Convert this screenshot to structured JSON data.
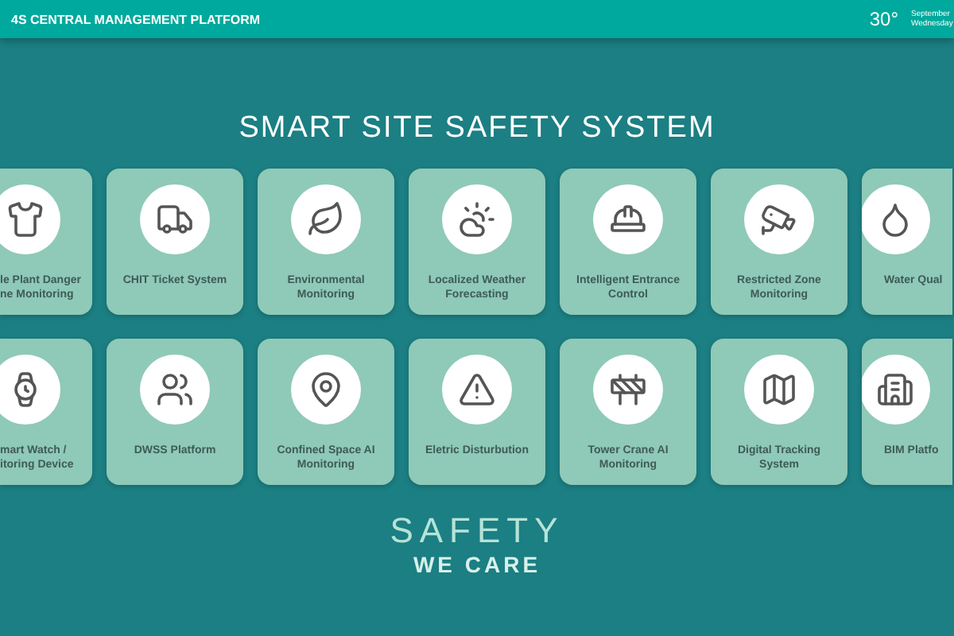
{
  "header": {
    "title": "4S CENTRAL MANAGEMENT PLATFORM",
    "temperature": "30°",
    "date": "September",
    "weekday": "Wednesday"
  },
  "heading": "SMART SITE SAFETY SYSTEM",
  "rows": [
    [
      {
        "kind": "left",
        "lines": [
          "le Plant Danger",
          "ne Monitoring"
        ]
      },
      {
        "kind": "full",
        "lines": [
          "CHIT Ticket System"
        ]
      },
      {
        "kind": "full",
        "lines": [
          "Environmental",
          "Monitoring"
        ]
      },
      {
        "kind": "full",
        "lines": [
          "Localized Weather",
          "Forecasting"
        ]
      },
      {
        "kind": "full",
        "lines": [
          "Intelligent Entrance",
          "Control"
        ]
      },
      {
        "kind": "full",
        "lines": [
          "Restricted Zone",
          "Monitoring"
        ]
      },
      {
        "kind": "right",
        "lines": [
          "Water Qual"
        ]
      }
    ],
    [
      {
        "kind": "left",
        "lines": [
          "mart Watch /",
          "itoring Device"
        ]
      },
      {
        "kind": "full",
        "lines": [
          "DWSS Platform"
        ]
      },
      {
        "kind": "full",
        "lines": [
          "Confined Space AI",
          "Monitoring"
        ]
      },
      {
        "kind": "full",
        "lines": [
          "Eletric Disturbution"
        ]
      },
      {
        "kind": "full",
        "lines": [
          "Tower Crane AI",
          "Monitoring"
        ]
      },
      {
        "kind": "full",
        "lines": [
          "Digital Tracking",
          "System"
        ]
      },
      {
        "kind": "right",
        "lines": [
          "BIM Platfo"
        ]
      }
    ]
  ],
  "slogan": {
    "line_1": "SAFETY",
    "line_2": "WE CARE"
  }
}
